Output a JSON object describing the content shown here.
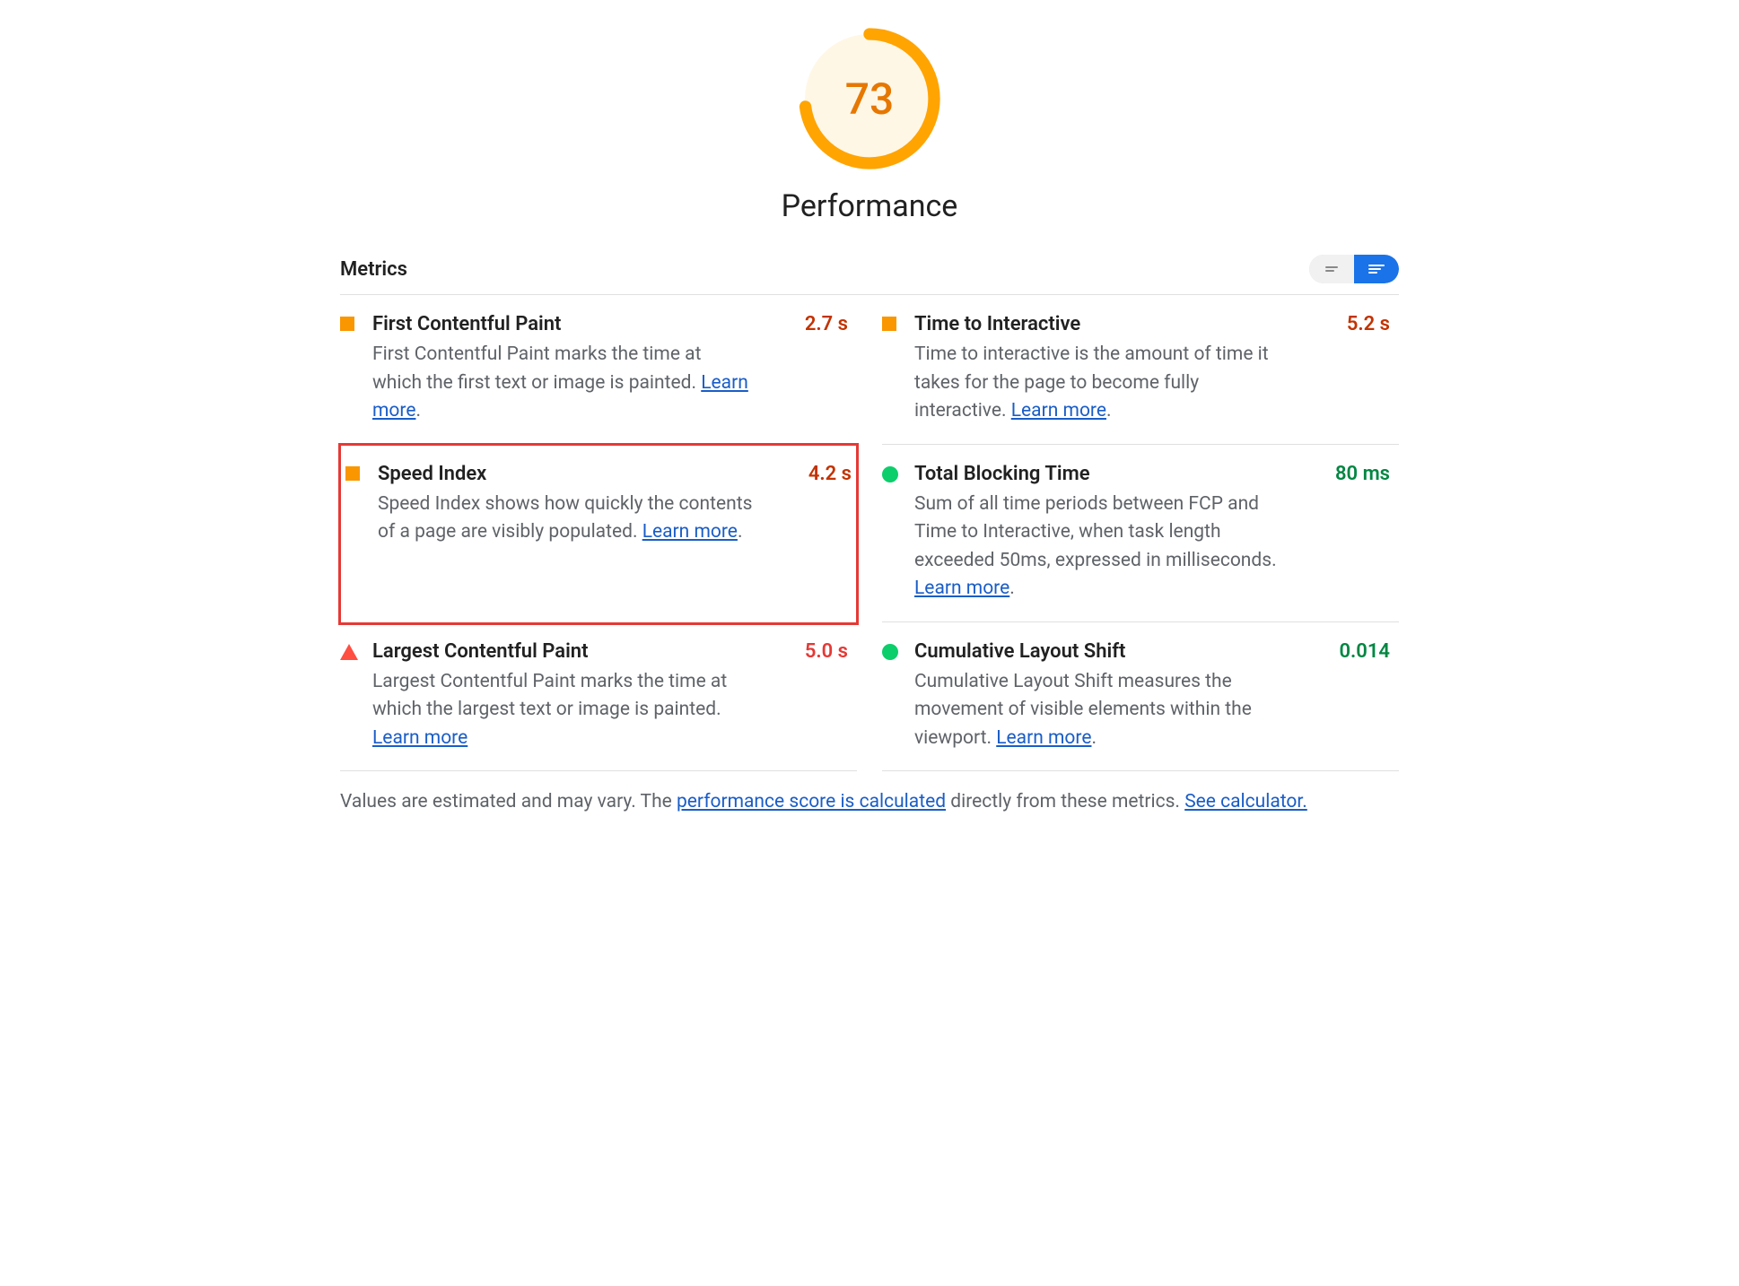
{
  "gauge": {
    "score": "73",
    "label": "Performance",
    "percent": 73,
    "color": "#ffa400",
    "bg": "#fff7e6"
  },
  "metrics_header": "Metrics",
  "metrics": [
    {
      "title": "First Contentful Paint",
      "desc": "First Contentful Paint marks the time at which the first text or image is painted. ",
      "learn": "Learn more",
      "value": "2.7 s",
      "status": "orange",
      "icon": "square",
      "highlight": false,
      "trailing_period": true
    },
    {
      "title": "Time to Interactive",
      "desc": "Time to interactive is the amount of time it takes for the page to become fully interactive. ",
      "learn": "Learn more",
      "value": "5.2 s",
      "status": "orange",
      "icon": "square",
      "highlight": false,
      "trailing_period": true
    },
    {
      "title": "Speed Index",
      "desc": "Speed Index shows how quickly the contents of a page are visibly populated. ",
      "learn": "Learn more",
      "value": "4.2 s",
      "status": "orange",
      "icon": "square",
      "highlight": true,
      "trailing_period": true
    },
    {
      "title": "Total Blocking Time",
      "desc": "Sum of all time periods between FCP and Time to Interactive, when task length exceeded 50ms, expressed in milliseconds. ",
      "learn": "Learn more",
      "value": "80 ms",
      "status": "green",
      "icon": "circle",
      "highlight": false,
      "trailing_period": true
    },
    {
      "title": "Largest Contentful Paint",
      "desc": "Largest Contentful Paint marks the time at which the largest text or image is painted. ",
      "learn": "Learn more",
      "value": "5.0 s",
      "status": "red",
      "icon": "triangle",
      "highlight": false,
      "trailing_period": false
    },
    {
      "title": "Cumulative Layout Shift",
      "desc": "Cumulative Layout Shift measures the movement of visible elements within the viewport. ",
      "learn": "Learn more",
      "value": "0.014",
      "status": "green",
      "icon": "circle",
      "highlight": false,
      "trailing_period": true
    }
  ],
  "footnote": {
    "prefix": "Values are estimated and may vary. The ",
    "link1": "performance score is calculated",
    "mid": " directly from these metrics. ",
    "link2": "See calculator."
  }
}
